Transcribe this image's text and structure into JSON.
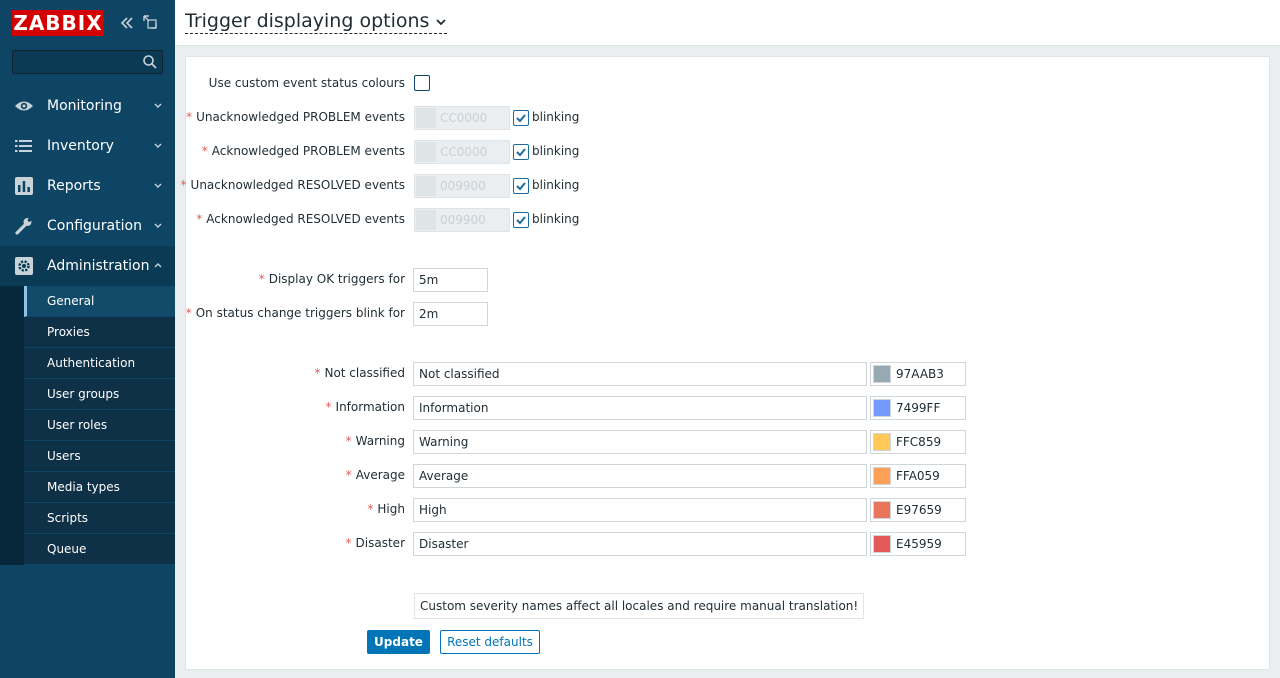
{
  "sidebar": {
    "logo": "ZABBIX",
    "search": {
      "value": "",
      "placeholder": ""
    },
    "menu": [
      {
        "label": "Monitoring",
        "icon": "eye-icon"
      },
      {
        "label": "Inventory",
        "icon": "list-icon"
      },
      {
        "label": "Reports",
        "icon": "bar-chart-icon"
      },
      {
        "label": "Configuration",
        "icon": "wrench-icon"
      },
      {
        "label": "Administration",
        "icon": "gear-icon"
      }
    ],
    "submenu": [
      "General",
      "Proxies",
      "Authentication",
      "User groups",
      "User roles",
      "Users",
      "Media types",
      "Scripts",
      "Queue"
    ]
  },
  "header": {
    "title": "Trigger displaying options"
  },
  "form": {
    "custom_colours": {
      "label": "Use custom event status colours",
      "checked": false
    },
    "event_colours": [
      {
        "label": "Unacknowledged PROBLEM events",
        "code": "CC0000",
        "blinking": true
      },
      {
        "label": "Acknowledged PROBLEM events",
        "code": "CC0000",
        "blinking": true
      },
      {
        "label": "Unacknowledged RESOLVED events",
        "code": "009900",
        "blinking": true
      },
      {
        "label": "Acknowledged RESOLVED events",
        "code": "009900",
        "blinking": true
      }
    ],
    "blinking_label": "blinking",
    "display_ok": {
      "label": "Display OK triggers for",
      "value": "5m"
    },
    "blink_period": {
      "label": "On status change triggers blink for",
      "value": "2m"
    },
    "severities": [
      {
        "label": "Not classified",
        "value": "Not classified",
        "code": "97AAB3",
        "color": "#97AAB3"
      },
      {
        "label": "Information",
        "value": "Information",
        "code": "7499FF",
        "color": "#7499FF"
      },
      {
        "label": "Warning",
        "value": "Warning",
        "code": "FFC859",
        "color": "#FFC859"
      },
      {
        "label": "Average",
        "value": "Average",
        "code": "FFA059",
        "color": "#FFA059"
      },
      {
        "label": "High",
        "value": "High",
        "code": "E97659",
        "color": "#E97659"
      },
      {
        "label": "Disaster",
        "value": "Disaster",
        "code": "E45959",
        "color": "#E45959"
      }
    ],
    "notice": "Custom severity names affect all locales and require manual translation!",
    "update_label": "Update",
    "reset_label": "Reset defaults"
  }
}
